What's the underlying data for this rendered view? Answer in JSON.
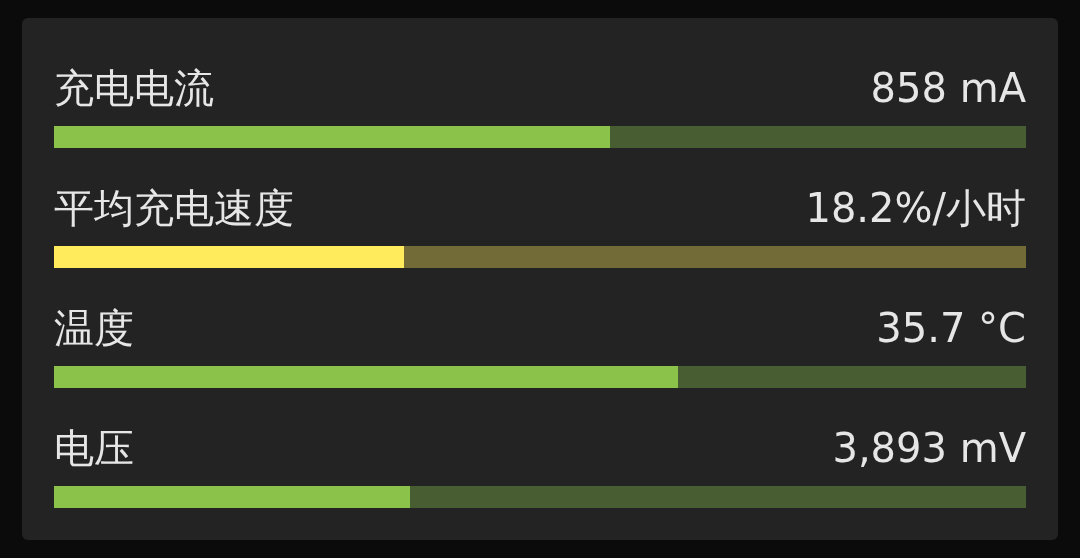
{
  "rows": [
    {
      "label": "充电电流",
      "reading": "858 mA",
      "level": 0.572,
      "color": "#8bc34a"
    },
    {
      "label": "平均充电速度",
      "reading": "18.2%/小时",
      "level": 0.36,
      "color": "#ffeb5b"
    },
    {
      "label": "温度",
      "reading": "35.7 °C",
      "level": 0.642,
      "color": "#8bc34a"
    },
    {
      "label": "电压",
      "reading": "3,893 mV",
      "level": 0.366,
      "color": "#8bc34a"
    }
  ]
}
